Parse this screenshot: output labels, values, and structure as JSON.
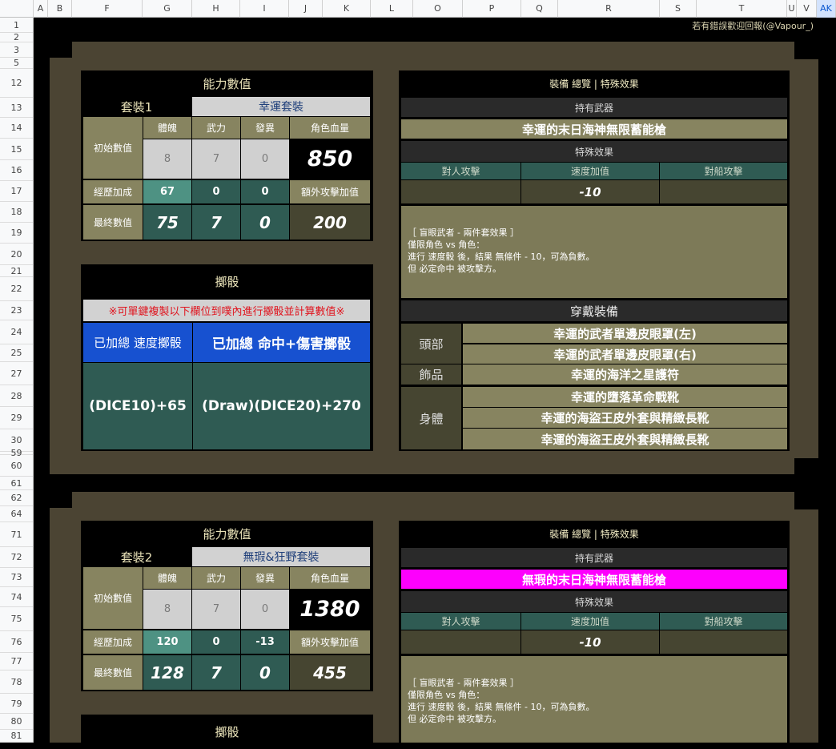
{
  "sheet": {
    "columns": [
      "A",
      "B",
      "F",
      "G",
      "H",
      "I",
      "J",
      "K",
      "L",
      "O",
      "P",
      "Q",
      "R",
      "S",
      "T",
      "U",
      "V",
      "AK"
    ],
    "rows": [
      "1",
      "2",
      "3",
      "5",
      "12",
      "13",
      "14",
      "15",
      "16",
      "17",
      "18",
      "19",
      "20",
      "21",
      "22",
      "23",
      "24",
      "25",
      "27",
      "28",
      "29",
      "30",
      "59",
      "60",
      "61",
      "62",
      "64",
      "71",
      "72",
      "73",
      "74",
      "75",
      "76",
      "77",
      "78",
      "79",
      "80",
      "81"
    ],
    "credit": "若有錯誤歡迎回報(@Vapour_)"
  },
  "sets": [
    {
      "stats_title": "能力數值",
      "set_label": "套裝1",
      "set_name": "幸運套裝",
      "headers": {
        "body": "體魄",
        "force": "武力",
        "mutation": "發異",
        "hp": "角色血量"
      },
      "row_initial": "初始數值",
      "row_exp": "經歷加成",
      "row_final": "最終數值",
      "initial": {
        "body": "8",
        "force": "7",
        "mutation": "0",
        "hp": "850"
      },
      "exp": {
        "body": "67",
        "force": "0",
        "mutation": "0",
        "extra_label": "額外攻擊加值"
      },
      "final": {
        "body": "75",
        "force": "7",
        "mutation": "0",
        "extra": "200"
      },
      "dice_title": "擲骰",
      "dice_notice": "※可單鍵複製以下欄位到噗內進行擲骰並計算數值※",
      "dice_speed_label": "已加總  速度擲骰",
      "dice_hit_label": "已加總 命中+傷害擲骰",
      "dice_speed_formula": "(DICE10)+65",
      "dice_hit_formula": "(Draw)(DICE20)+270",
      "equip_title": "裝備 總覽 | 特殊效果",
      "weapon_header": "持有武器",
      "weapon_name": "幸運的末日海神無限蓄能槍",
      "effect_header": "特殊效果",
      "effect_cols": {
        "pvp": "對人攻擊",
        "speed": "速度加值",
        "ship": "對船攻擊"
      },
      "effect_vals": {
        "pvp": "",
        "speed": "-10",
        "ship": ""
      },
      "effect_text": [
        "［ 盲眼武者 - 兩件套效果 ］",
        "僅限角色 vs 角色：",
        "進行 速度骰 後，結果 無條件 - 10，可為負數。",
        "但 必定命中 被攻擊方。"
      ],
      "wear_title": "穿戴裝備",
      "slots": {
        "head": "頭部",
        "accessory": "飾品",
        "body": "身體"
      },
      "head_items": [
        "幸運的武者單邊皮眼罩(左)",
        "幸運的武者單邊皮眼罩(右)"
      ],
      "accessory_items": [
        "幸運的海洋之星護符"
      ],
      "body_items": [
        "幸運的墮落革命戰靴",
        "幸運的海盜王皮外套與精緻長靴",
        "幸運的海盜王皮外套與精緻長靴"
      ]
    },
    {
      "stats_title": "能力數值",
      "set_label": "套裝2",
      "set_name": "無瑕&狂野套裝",
      "headers": {
        "body": "體魄",
        "force": "武力",
        "mutation": "發異",
        "hp": "角色血量"
      },
      "row_initial": "初始數值",
      "row_exp": "經歷加成",
      "row_final": "最終數值",
      "initial": {
        "body": "8",
        "force": "7",
        "mutation": "0",
        "hp": "1380"
      },
      "exp": {
        "body": "120",
        "force": "0",
        "mutation": "-13",
        "extra_label": "額外攻擊加值"
      },
      "final": {
        "body": "128",
        "force": "7",
        "mutation": "0",
        "extra": "455"
      },
      "dice_title": "擲骰",
      "equip_title": "裝備 總覽 | 特殊效果",
      "weapon_header": "持有武器",
      "weapon_name": "無瑕的末日海神無限蓄能槍",
      "effect_header": "特殊效果",
      "effect_cols": {
        "pvp": "對人攻擊",
        "speed": "速度加值",
        "ship": "對船攻擊"
      },
      "effect_vals": {
        "pvp": "",
        "speed": "-10",
        "ship": ""
      },
      "effect_text": [
        "［ 盲眼武者 - 兩件套效果 ］",
        "僅限角色 vs 角色：",
        "進行 速度骰 後，結果 無條件 - 10，可為負數。",
        "但 必定命中 被攻擊方。"
      ]
    }
  ]
}
